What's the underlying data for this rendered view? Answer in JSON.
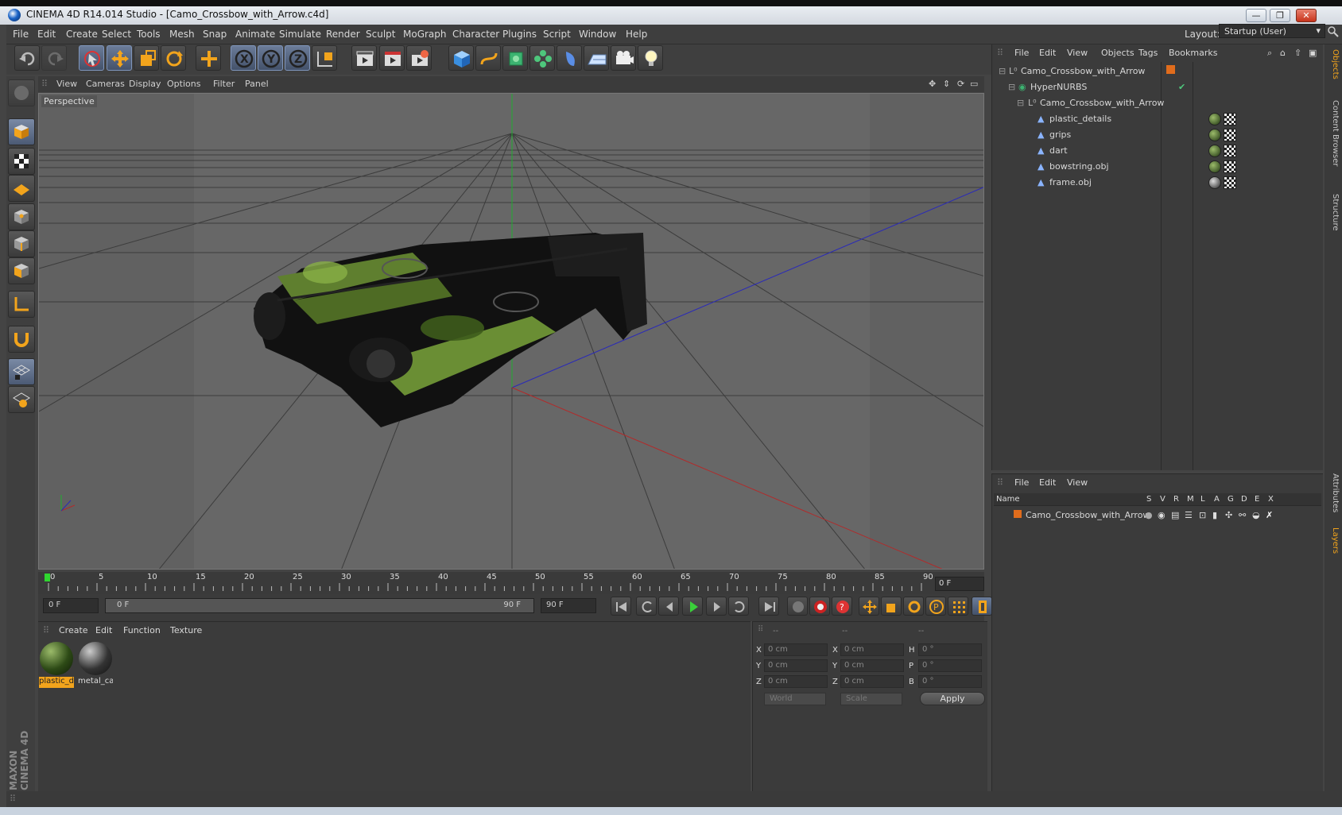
{
  "window": {
    "title": "CINEMA 4D R14.014 Studio - [Camo_Crossbow_with_Arrow.c4d]",
    "min": "—",
    "max": "❐",
    "close": "✕"
  },
  "menu": [
    "File",
    "Edit",
    "Create",
    "Select",
    "Tools",
    "Mesh",
    "Snap",
    "Animate",
    "Simulate",
    "Render",
    "Sculpt",
    "MoGraph",
    "Character",
    "Plugins",
    "Script",
    "Window",
    "Help"
  ],
  "layout": {
    "label": "Layout:",
    "value": "Startup (User)"
  },
  "viewport": {
    "menu": [
      "View",
      "Cameras",
      "Display",
      "Options",
      "Filter",
      "Panel"
    ],
    "label": "Perspective"
  },
  "timeline": {
    "ticks": [
      "0",
      "5",
      "10",
      "15",
      "20",
      "25",
      "30",
      "35",
      "40",
      "45",
      "50",
      "55",
      "60",
      "65",
      "70",
      "75",
      "80",
      "85",
      "90"
    ],
    "frame_display": "0 F"
  },
  "transport": {
    "start": "0 F",
    "slider_start": "0 F",
    "slider_end": "90 F",
    "end": "90 F"
  },
  "materials": {
    "menu": [
      "Create",
      "Edit",
      "Function",
      "Texture"
    ],
    "items": [
      "plastic_d",
      "metal_ca"
    ]
  },
  "coords": {
    "headers": [
      "--",
      "--",
      "--"
    ],
    "rows": [
      {
        "a": "X",
        "av": "0 cm",
        "b": "X",
        "bv": "0 cm",
        "c": "H",
        "cv": "0 °"
      },
      {
        "a": "Y",
        "av": "0 cm",
        "b": "Y",
        "bv": "0 cm",
        "c": "P",
        "cv": "0 °"
      },
      {
        "a": "Z",
        "av": "0 cm",
        "b": "Z",
        "bv": "0 cm",
        "c": "B",
        "cv": "0 °"
      }
    ],
    "world": "World",
    "scale": "Scale",
    "apply": "Apply"
  },
  "objects": {
    "menu": [
      "File",
      "Edit",
      "View",
      "Objects",
      "Tags",
      "Bookmarks"
    ],
    "tree": [
      {
        "name": "Camo_Crossbow_with_Arrow",
        "indent": 0
      },
      {
        "name": "HyperNURBS",
        "indent": 1
      },
      {
        "name": "Camo_Crossbow_with_Arrow",
        "indent": 2
      },
      {
        "name": "plastic_details",
        "indent": 3
      },
      {
        "name": "grips",
        "indent": 3
      },
      {
        "name": "dart",
        "indent": 3
      },
      {
        "name": "bowstring.obj",
        "indent": 3
      },
      {
        "name": "frame.obj",
        "indent": 3
      }
    ]
  },
  "layers": {
    "menu": [
      "File",
      "Edit",
      "View"
    ],
    "columns": [
      "Name",
      "S",
      "V",
      "R",
      "M",
      "L",
      "A",
      "G",
      "D",
      "E",
      "X"
    ],
    "row": "Camo_Crossbow_with_Arrow"
  },
  "righttabs": [
    "Objects",
    "Content Browser",
    "Structure",
    "Attributes",
    "Layers"
  ],
  "logo": "MAXON CINEMA 4D"
}
